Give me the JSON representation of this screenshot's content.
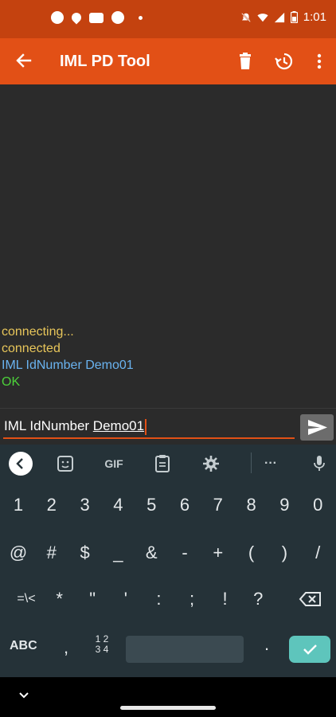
{
  "status_bar": {
    "time": "1:01",
    "notification_icons": [
      "chat-icon",
      "hand-icon",
      "youtube-icon",
      "settings-icon",
      "dot-icon"
    ],
    "system_icons": [
      "mute-icon",
      "wifi-icon",
      "signal-icon",
      "battery-icon"
    ]
  },
  "app_bar": {
    "title": "IML PD Tool",
    "actions": [
      "delete-icon",
      "history-icon",
      "more-icon"
    ]
  },
  "console": {
    "lines": [
      {
        "text": "connecting...",
        "color": "#e8c65a"
      },
      {
        "text": "connected",
        "color": "#e8c65a"
      },
      {
        "text": "IML IdNumber Demo01",
        "color": "#6ab3f0"
      },
      {
        "text": "OK",
        "color": "#4cd13a"
      }
    ]
  },
  "input": {
    "value_prefix": "IML IdNumber ",
    "value_composing": "Demo01"
  },
  "keyboard": {
    "toolbar": {
      "gif_label": "GIF",
      "more_label": "···"
    },
    "row1": [
      "1",
      "2",
      "3",
      "4",
      "5",
      "6",
      "7",
      "8",
      "9",
      "0"
    ],
    "row2": [
      "@",
      "#",
      "$",
      "_",
      "&",
      "-",
      "+",
      "(",
      ")",
      "/"
    ],
    "row3": [
      "=\\<",
      "*",
      "\"",
      "'",
      ":",
      ";",
      "!",
      "?"
    ],
    "abc_label": "ABC",
    "comma_label": ",",
    "numpad_label_top": "1 2",
    "numpad_label_bottom": "3 4",
    "period_label": "."
  },
  "colors": {
    "status_bar": "#c4420f",
    "app_bar": "#e25016",
    "console_bg": "#2b2b2b",
    "keyboard_bg": "#253238",
    "enter_key": "#5ec5bc"
  }
}
